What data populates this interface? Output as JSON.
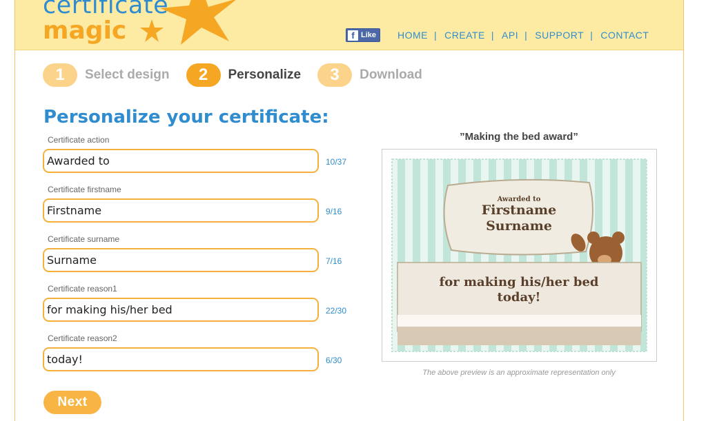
{
  "logo": {
    "line1": "certificate",
    "line2": "magic"
  },
  "header": {
    "like_label": "Like",
    "nav": [
      "HOME",
      "CREATE",
      "API",
      "SUPPORT",
      "CONTACT"
    ]
  },
  "steps": [
    {
      "num": "1",
      "label": "Select design",
      "state": "inactive"
    },
    {
      "num": "2",
      "label": "Personalize",
      "state": "active"
    },
    {
      "num": "3",
      "label": "Download",
      "state": "inactive"
    }
  ],
  "form": {
    "title": "Personalize your certificate:",
    "fields": [
      {
        "label": "Certificate action",
        "value": "Awarded to",
        "count": "10/37"
      },
      {
        "label": "Certificate firstname",
        "value": "Firstname",
        "count": "9/16"
      },
      {
        "label": "Certificate surname",
        "value": "Surname",
        "count": "7/16"
      },
      {
        "label": "Certificate reason1",
        "value": "for making his/her bed",
        "count": "22/30"
      },
      {
        "label": "Certificate reason2",
        "value": "today!",
        "count": "6/30"
      }
    ],
    "next_label": "Next"
  },
  "preview": {
    "title": "”Making the bed award”",
    "action": "Awarded to",
    "firstname": "Firstname",
    "surname": "Surname",
    "reason1": "for making his/her bed",
    "reason2": "today!",
    "note": "The above preview is an approximate representation only"
  },
  "colors": {
    "accent_orange": "#f5a623",
    "link_blue": "#2f8ccf",
    "header_bg": "#fdeba4"
  }
}
